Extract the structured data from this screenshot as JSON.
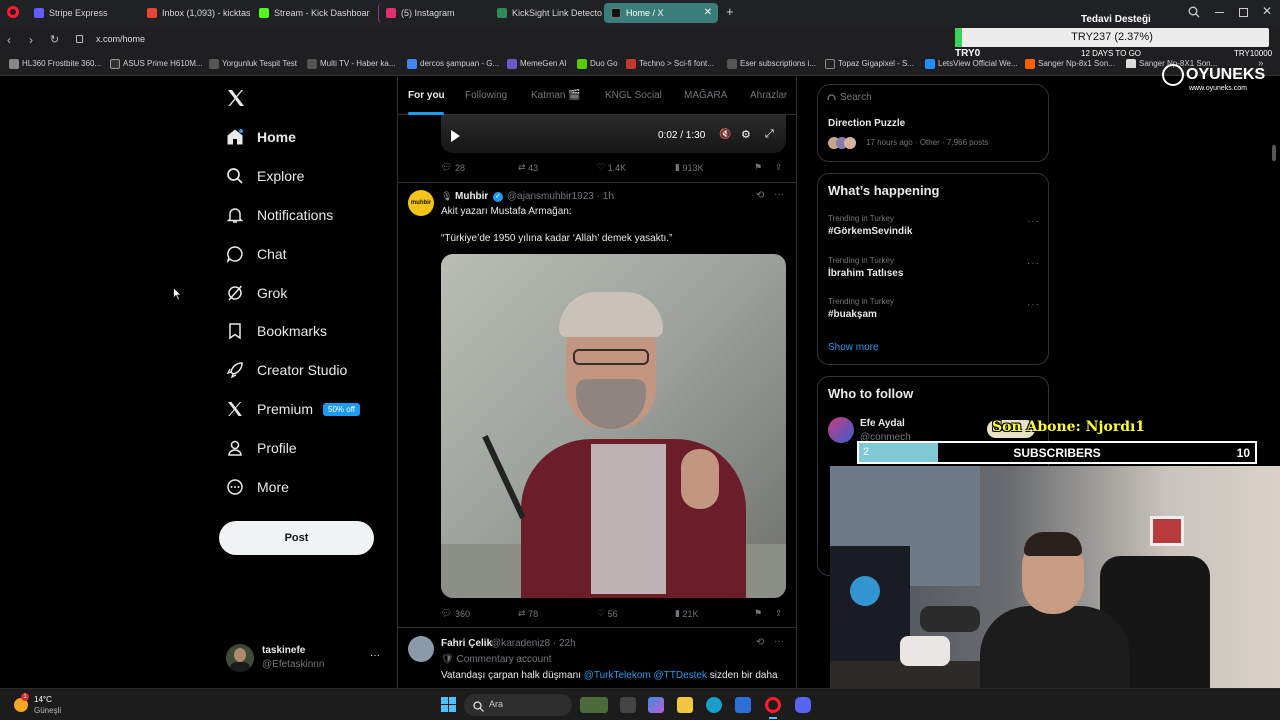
{
  "browser": {
    "tabs": [
      {
        "label": "Stripe Express",
        "color": "#635bff"
      },
      {
        "label": "Inbox (1,093) - kicktaskinef",
        "color": "#ea4335"
      },
      {
        "label": "Stream - Kick Dashboard",
        "color": "#53fc18"
      },
      {
        "label": "(5) Instagram",
        "color": "#e1306c"
      },
      {
        "label": "KickSight Link Detector",
        "color": "#2e8b57"
      },
      {
        "label": "Home / X",
        "color": "#000000"
      }
    ],
    "url": "x.com/home",
    "bookmarks": [
      "HL360 Frostbite 360...",
      "ASUS Prime H610M...",
      "Yorgunluk Tespit Test",
      "Multi TV - Haber ka...",
      "dercos şampuan - G...",
      "MemeGen AI",
      "Duo Go",
      "Techno > Sci-fi font...",
      "Eser subscriptions i...",
      "Topaz Gigapixel - S...",
      "LetsView Official We...",
      "Sanger Np-8x1 Son...",
      "Sanger Np-8X1 Son..."
    ]
  },
  "overlay": {
    "donation_title": "Tedavi Desteği",
    "donation_amount": "TRY237 (2.37%)",
    "donation_left": "TRY0",
    "donation_days": "12 DAYS TO GO",
    "donation_right": "TRY10000",
    "brand": "OYUNEKS",
    "brand_url": "www.oyuneks.com",
    "last_sub": "Son Abone: Njordı1",
    "sub_current": "2",
    "sub_label": "SUBSCRIBERS",
    "sub_goal": "10",
    "sub_progress": 0.2
  },
  "sidebar": {
    "items": [
      {
        "label": "Home",
        "icon": "home-icon"
      },
      {
        "label": "Explore",
        "icon": "search-icon"
      },
      {
        "label": "Notifications",
        "icon": "bell-icon"
      },
      {
        "label": "Chat",
        "icon": "chat-icon"
      },
      {
        "label": "Grok",
        "icon": "grok-icon"
      },
      {
        "label": "Bookmarks",
        "icon": "bookmark-icon"
      },
      {
        "label": "Creator Studio",
        "icon": "rocket-icon"
      },
      {
        "label": "Premium",
        "icon": "x-icon"
      },
      {
        "label": "Profile",
        "icon": "person-icon"
      },
      {
        "label": "More",
        "icon": "more-icon"
      }
    ],
    "premium_badge": "50% off",
    "post_button": "Post",
    "account_name": "taskinefe",
    "account_handle": "@Efetaskinnn"
  },
  "feed": {
    "tabs": [
      "For you",
      "Following",
      "Katman 🎬",
      "KNGL Social",
      "MAĞARA",
      "Ahrazlar"
    ],
    "video_time": "0:02 / 1:30",
    "tweet0_actions": {
      "replies": "28",
      "reposts": "43",
      "likes": "1.4K",
      "views": "913K"
    },
    "tweet1": {
      "name": "Muhbir",
      "handle": "@ajansmuhbir1923 · 1h",
      "avatar_text": "muhbir",
      "line1": "Akit yazarı Mustafa Armağan:",
      "line2": "“Türkiye’de 1950 yılına kadar ‘Allah’ demek yasaktı.”",
      "replies": "360",
      "reposts": "78",
      "likes": "56",
      "views": "21K"
    },
    "tweet2": {
      "name": "Fahri Çelik",
      "handle": "@karadeniz8 · 22h",
      "label": "Commentary account",
      "text_pre": "Vatandaşı çarpan halk düşmanı ",
      "mention1": "@TurkTelekom",
      "mention2": "@TTDestek",
      "text_post": " sizden bir daha"
    }
  },
  "right": {
    "search_placeholder": "Search",
    "top_card_title": "Direction Puzzle",
    "top_card_meta": "17 hours ago · Other · 7,966 posts",
    "happening_title": "What’s happening",
    "trends": [
      {
        "context": "Trending in Turkey",
        "topic": "#GörkemSevindik"
      },
      {
        "context": "Trending in Turkey",
        "topic": "İbrahim Tatlıses"
      },
      {
        "context": "Trending in Turkey",
        "topic": "#buakşam"
      }
    ],
    "show_more": "Show more",
    "who_title": "Who to follow",
    "follow_name": "Efe Aydal",
    "follow_handle": "@conmech"
  },
  "taskbar": {
    "temp": "14°C",
    "weather": "Güneşli",
    "search": "Ara"
  }
}
